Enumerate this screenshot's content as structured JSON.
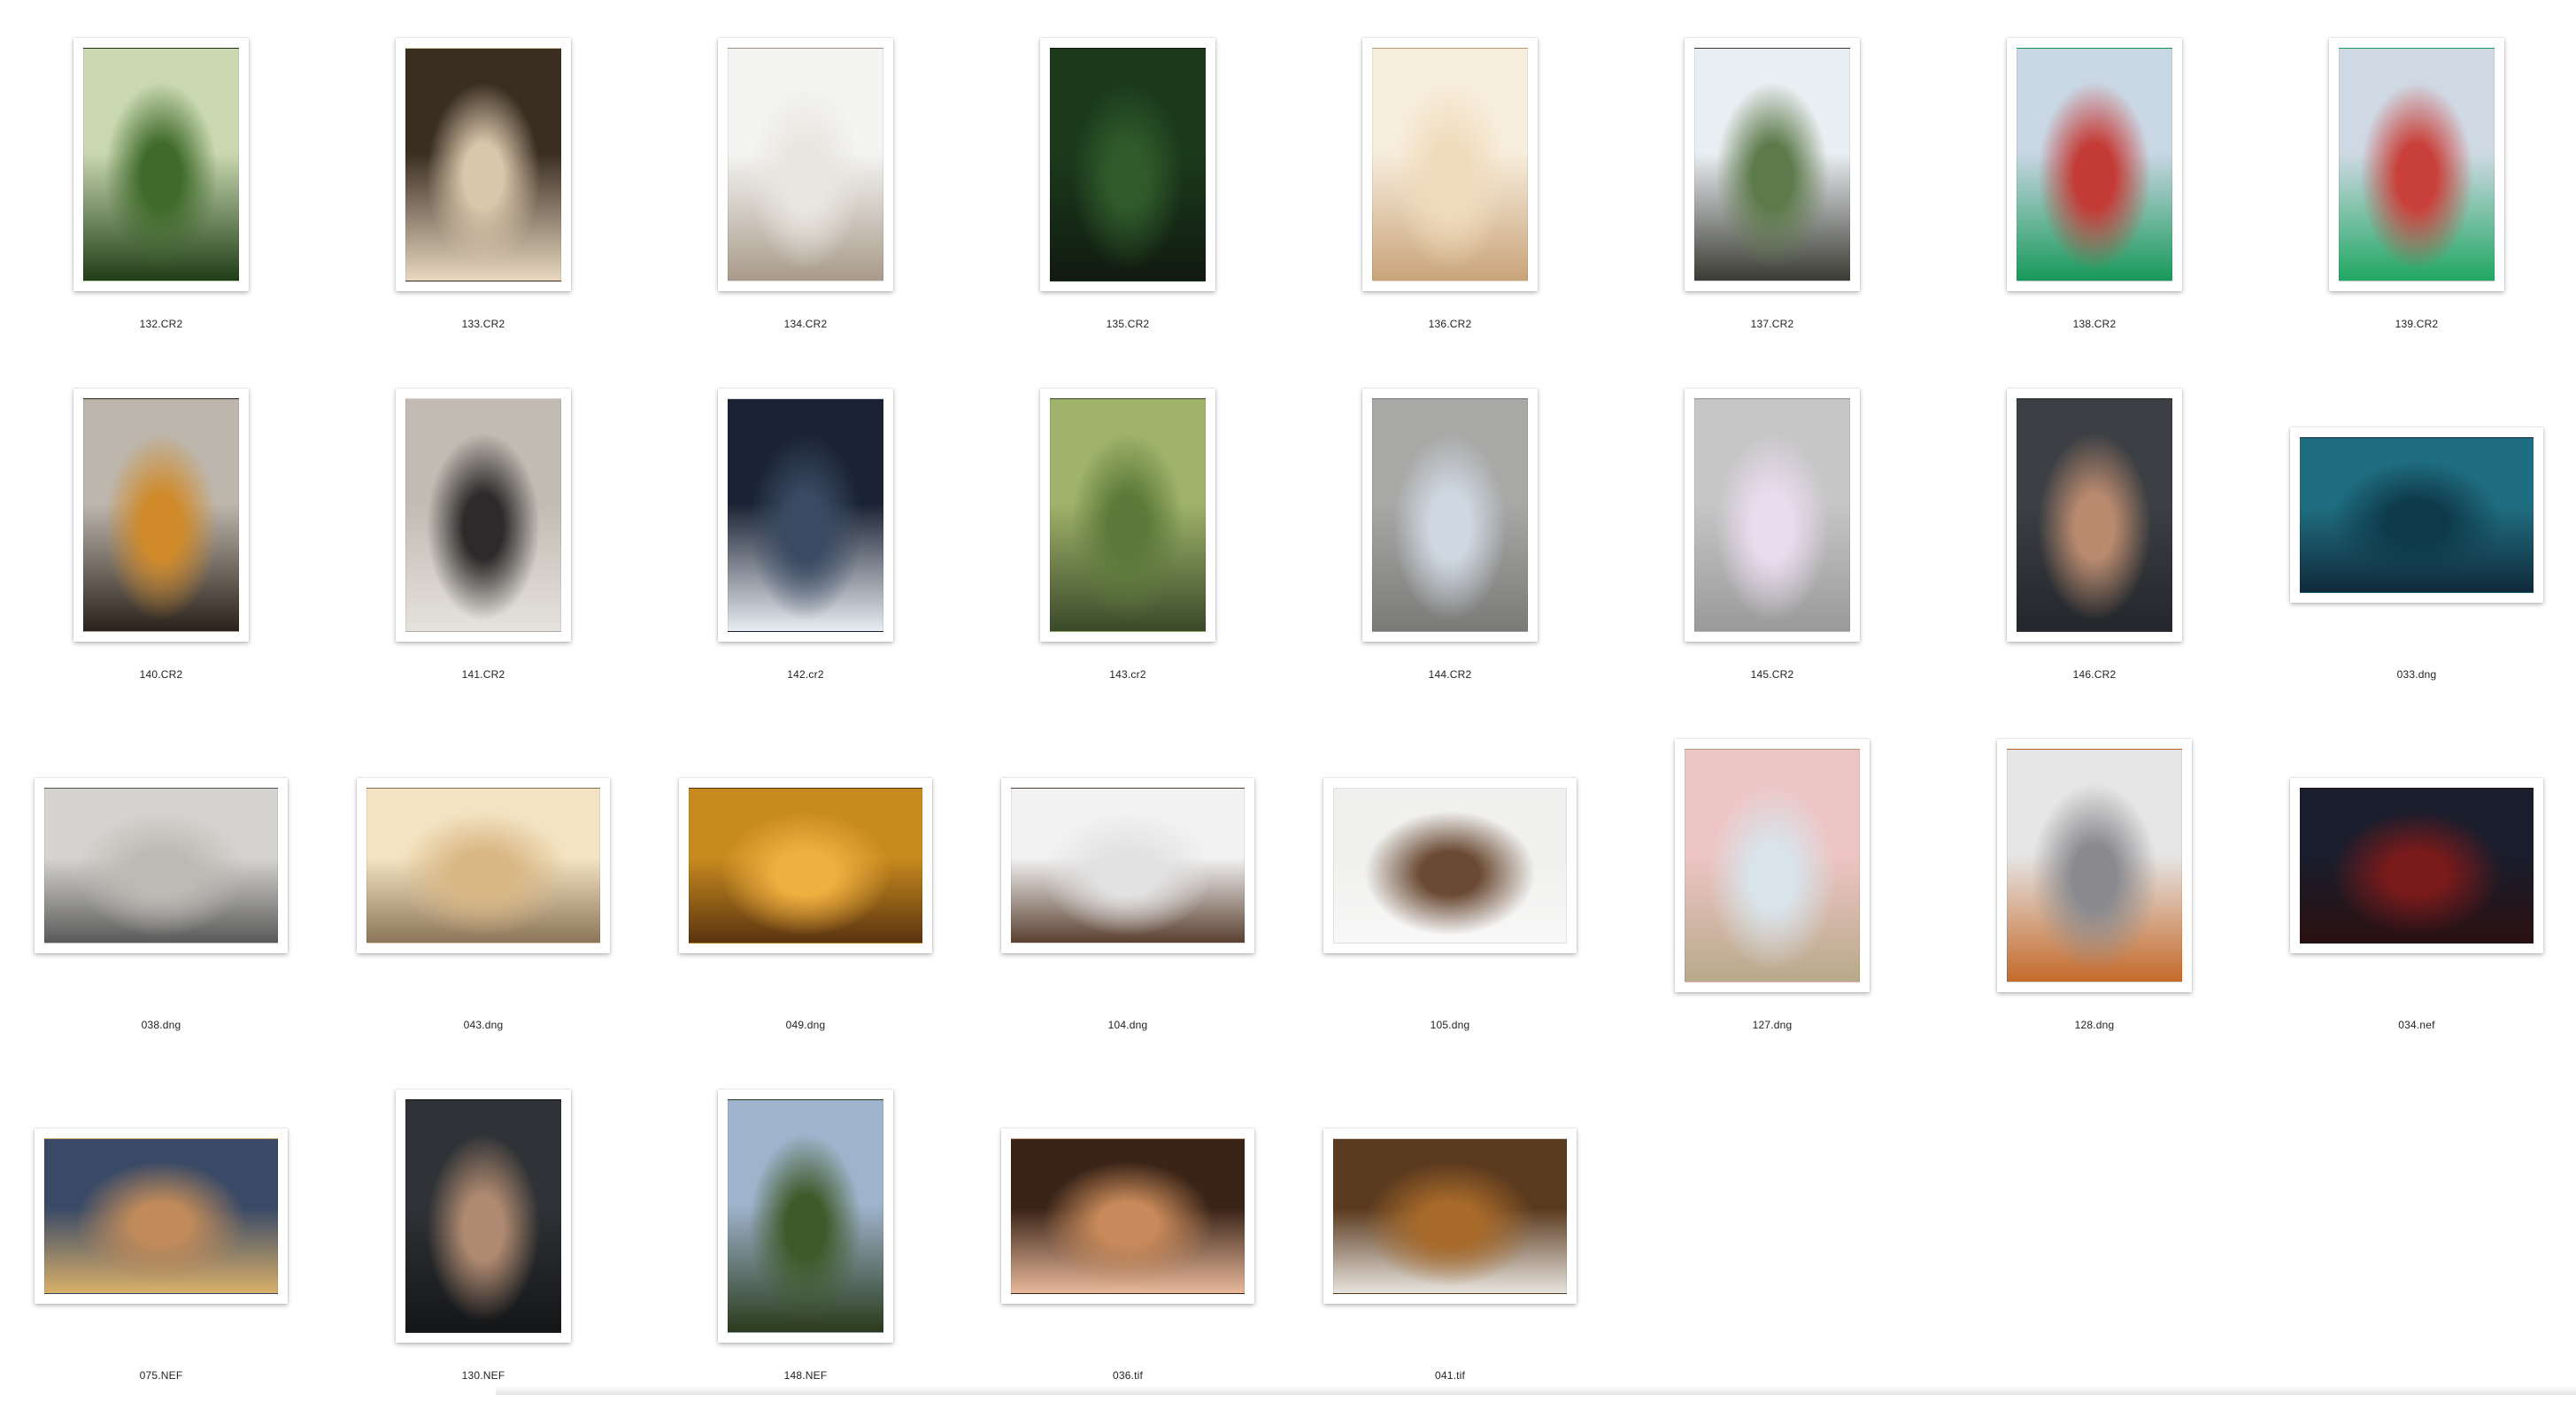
{
  "files": [
    {
      "name": "132.CR2",
      "orientation": "portrait",
      "colors": [
        "#c9d8b0",
        "#3f6a2a",
        "#1f3d17"
      ]
    },
    {
      "name": "133.CR2",
      "orientation": "portrait",
      "colors": [
        "#3a2e22",
        "#d9c7ab",
        "#e8d8c0"
      ]
    },
    {
      "name": "134.CR2",
      "orientation": "portrait",
      "colors": [
        "#f4f4f2",
        "#e9e6e0",
        "#a89a8a"
      ]
    },
    {
      "name": "135.CR2",
      "orientation": "portrait",
      "colors": [
        "#1b3a1c",
        "#2f5a2a",
        "#111a10"
      ]
    },
    {
      "name": "136.CR2",
      "orientation": "portrait",
      "colors": [
        "#f7eddc",
        "#f0dcbc",
        "#c9a47a"
      ]
    },
    {
      "name": "137.CR2",
      "orientation": "portrait",
      "colors": [
        "#e9eef2",
        "#5d7a4a",
        "#3b3b33"
      ]
    },
    {
      "name": "138.CR2",
      "orientation": "portrait",
      "colors": [
        "#c9d6e3",
        "#c43a35",
        "#18995a"
      ]
    },
    {
      "name": "139.CR2",
      "orientation": "portrait",
      "colors": [
        "#cfd9e4",
        "#c9403a",
        "#21a763"
      ]
    },
    {
      "name": "140.CR2",
      "orientation": "portrait",
      "colors": [
        "#bdb6ac",
        "#d08a2a",
        "#2a211a"
      ]
    },
    {
      "name": "141.CR2",
      "orientation": "portrait",
      "colors": [
        "#c2bbb3",
        "#2c2a2a",
        "#e5e1dc"
      ]
    },
    {
      "name": "142.cr2",
      "orientation": "portrait",
      "colors": [
        "#1a2333",
        "#3a4a63",
        "#e8ecf2"
      ]
    },
    {
      "name": "143.cr2",
      "orientation": "portrait",
      "colors": [
        "#9fb36a",
        "#5d7a3a",
        "#3a4a2a"
      ]
    },
    {
      "name": "144.CR2",
      "orientation": "portrait",
      "colors": [
        "#a8a8a6",
        "#cfd8e2",
        "#7a7a78"
      ]
    },
    {
      "name": "145.CR2",
      "orientation": "portrait",
      "colors": [
        "#c6c6c6",
        "#eadcef",
        "#9a9a9a"
      ]
    },
    {
      "name": "146.CR2",
      "orientation": "portrait",
      "colors": [
        "#3c3f44",
        "#b98a6e",
        "#23262a"
      ]
    },
    {
      "name": "033.dng",
      "orientation": "landscape",
      "colors": [
        "#1f6d80",
        "#0e3a4a",
        "#102a3a"
      ]
    },
    {
      "name": "038.dng",
      "orientation": "landscape",
      "colors": [
        "#d5d3cf",
        "#bdbab4",
        "#5a5a5a"
      ]
    },
    {
      "name": "043.dng",
      "orientation": "landscape",
      "colors": [
        "#f3e3c2",
        "#d9b784",
        "#8c7558"
      ]
    },
    {
      "name": "049.dng",
      "orientation": "landscape",
      "colors": [
        "#c78a1e",
        "#f0b040",
        "#5a3410"
      ]
    },
    {
      "name": "104.dng",
      "orientation": "landscape",
      "colors": [
        "#f2f2f2",
        "#e2e2e2",
        "#5a4030"
      ]
    },
    {
      "name": "105.dng",
      "orientation": "landscape",
      "colors": [
        "#f0f0ee",
        "#6a4a34",
        "#f8f8f8"
      ]
    },
    {
      "name": "127.dng",
      "orientation": "portrait",
      "colors": [
        "#eec5c5",
        "#d8e4ea",
        "#b8a98a"
      ]
    },
    {
      "name": "128.dng",
      "orientation": "portrait",
      "colors": [
        "#e6e6e6",
        "#8a8a8e",
        "#c46a2a"
      ]
    },
    {
      "name": "034.nef",
      "orientation": "landscape",
      "colors": [
        "#1a1d2c",
        "#7a1a1a",
        "#2a1010"
      ]
    },
    {
      "name": "075.NEF",
      "orientation": "landscape",
      "colors": [
        "#3a4a66",
        "#c08a5a",
        "#d9b06a"
      ]
    },
    {
      "name": "130.NEF",
      "orientation": "portrait",
      "colors": [
        "#2f3236",
        "#b08a70",
        "#141618"
      ]
    },
    {
      "name": "148.NEF",
      "orientation": "portrait",
      "colors": [
        "#9fb4cc",
        "#3e5a2a",
        "#2a3a1c"
      ]
    },
    {
      "name": "036.tif",
      "orientation": "landscape",
      "colors": [
        "#3a2418",
        "#c88a5a",
        "#e8b89a"
      ]
    },
    {
      "name": "041.tif",
      "orientation": "landscape",
      "colors": [
        "#5a3a1e",
        "#a86a2a",
        "#e8e4de"
      ]
    }
  ]
}
